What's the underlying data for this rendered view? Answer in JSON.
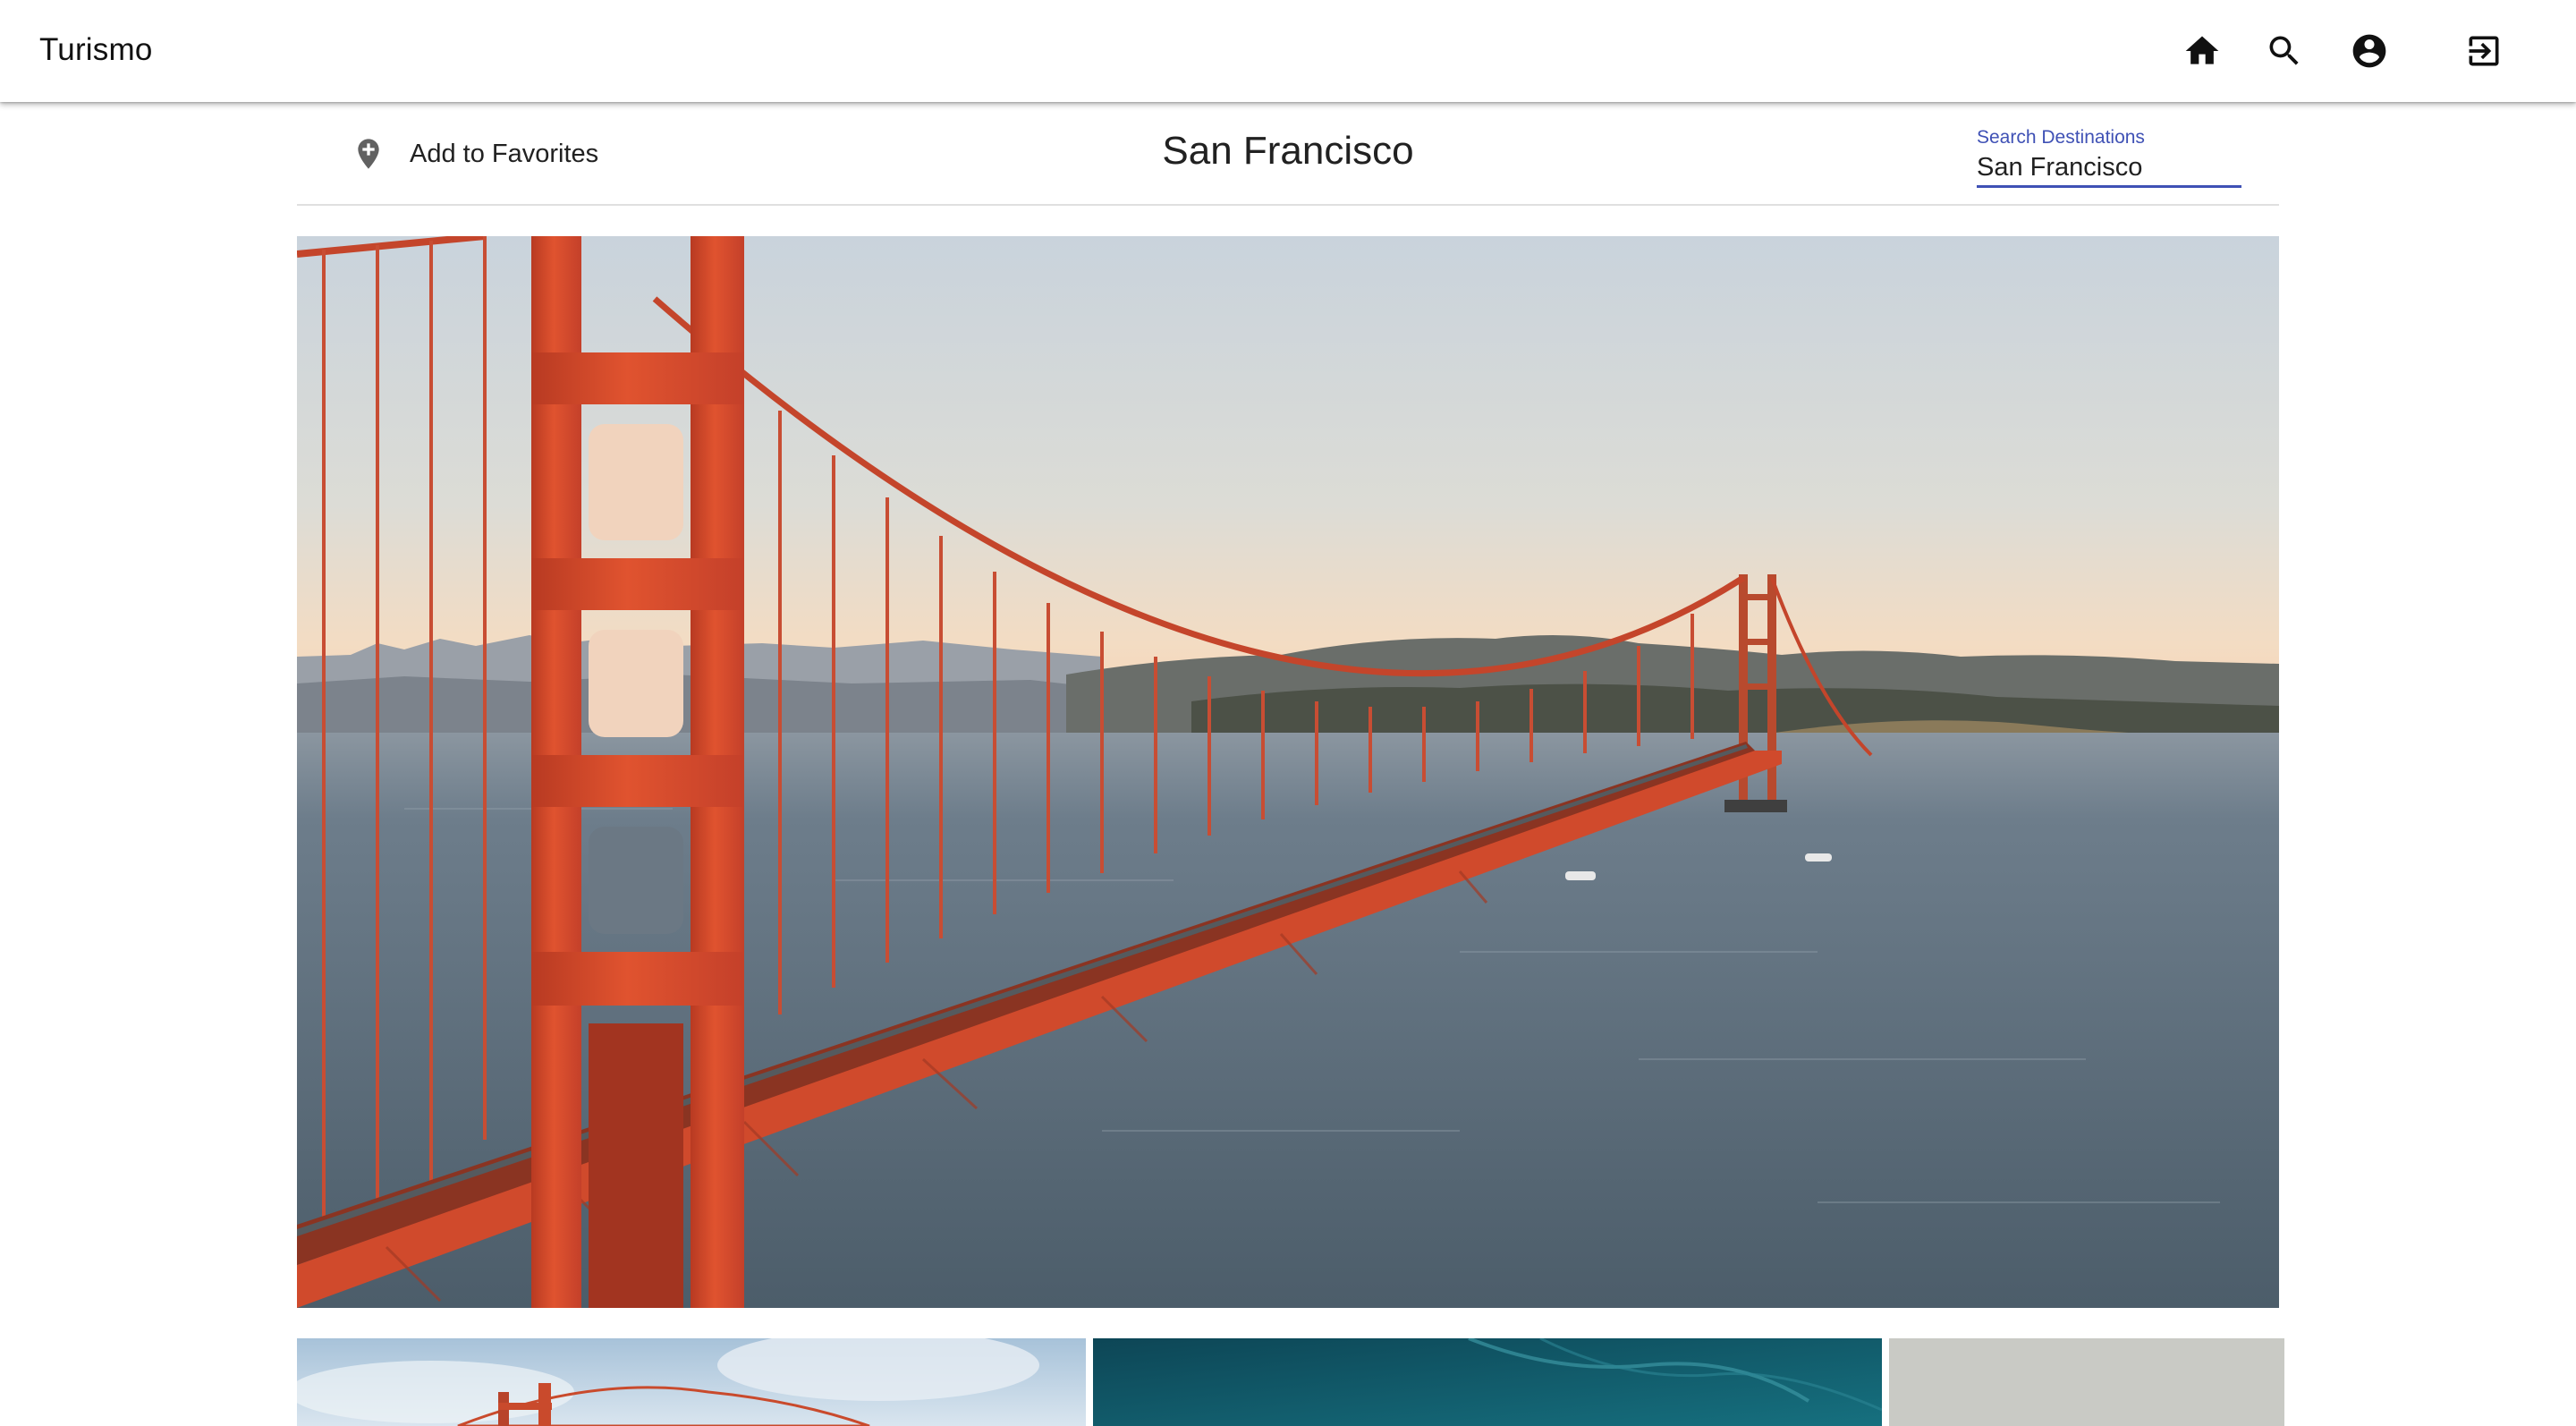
{
  "app": {
    "brand": "Turismo"
  },
  "nav": [
    {
      "name": "home-icon",
      "label": "Home"
    },
    {
      "name": "search-icon",
      "label": "Search"
    },
    {
      "name": "account-icon",
      "label": "Account"
    },
    {
      "name": "logout-icon",
      "label": "Log out"
    }
  ],
  "toolbar": {
    "favorite_label": "Add to Favorites",
    "title": "San Francisco",
    "search": {
      "label": "Search Destinations",
      "value": "San Francisco"
    }
  },
  "hero": {
    "subject": "Golden Gate Bridge at sunset"
  },
  "thumbnails": [
    {
      "subject": "Golden Gate Bridge tower under clouds"
    },
    {
      "subject": "Teal aerial view"
    },
    {
      "subject": "Grey sky"
    }
  ],
  "colors": {
    "accent": "#3f51b5",
    "bridge": "#d9472b",
    "water": "#5b6f80",
    "sky_top": "#c8d2dc",
    "sky_horizon": "#f6d4b6"
  }
}
